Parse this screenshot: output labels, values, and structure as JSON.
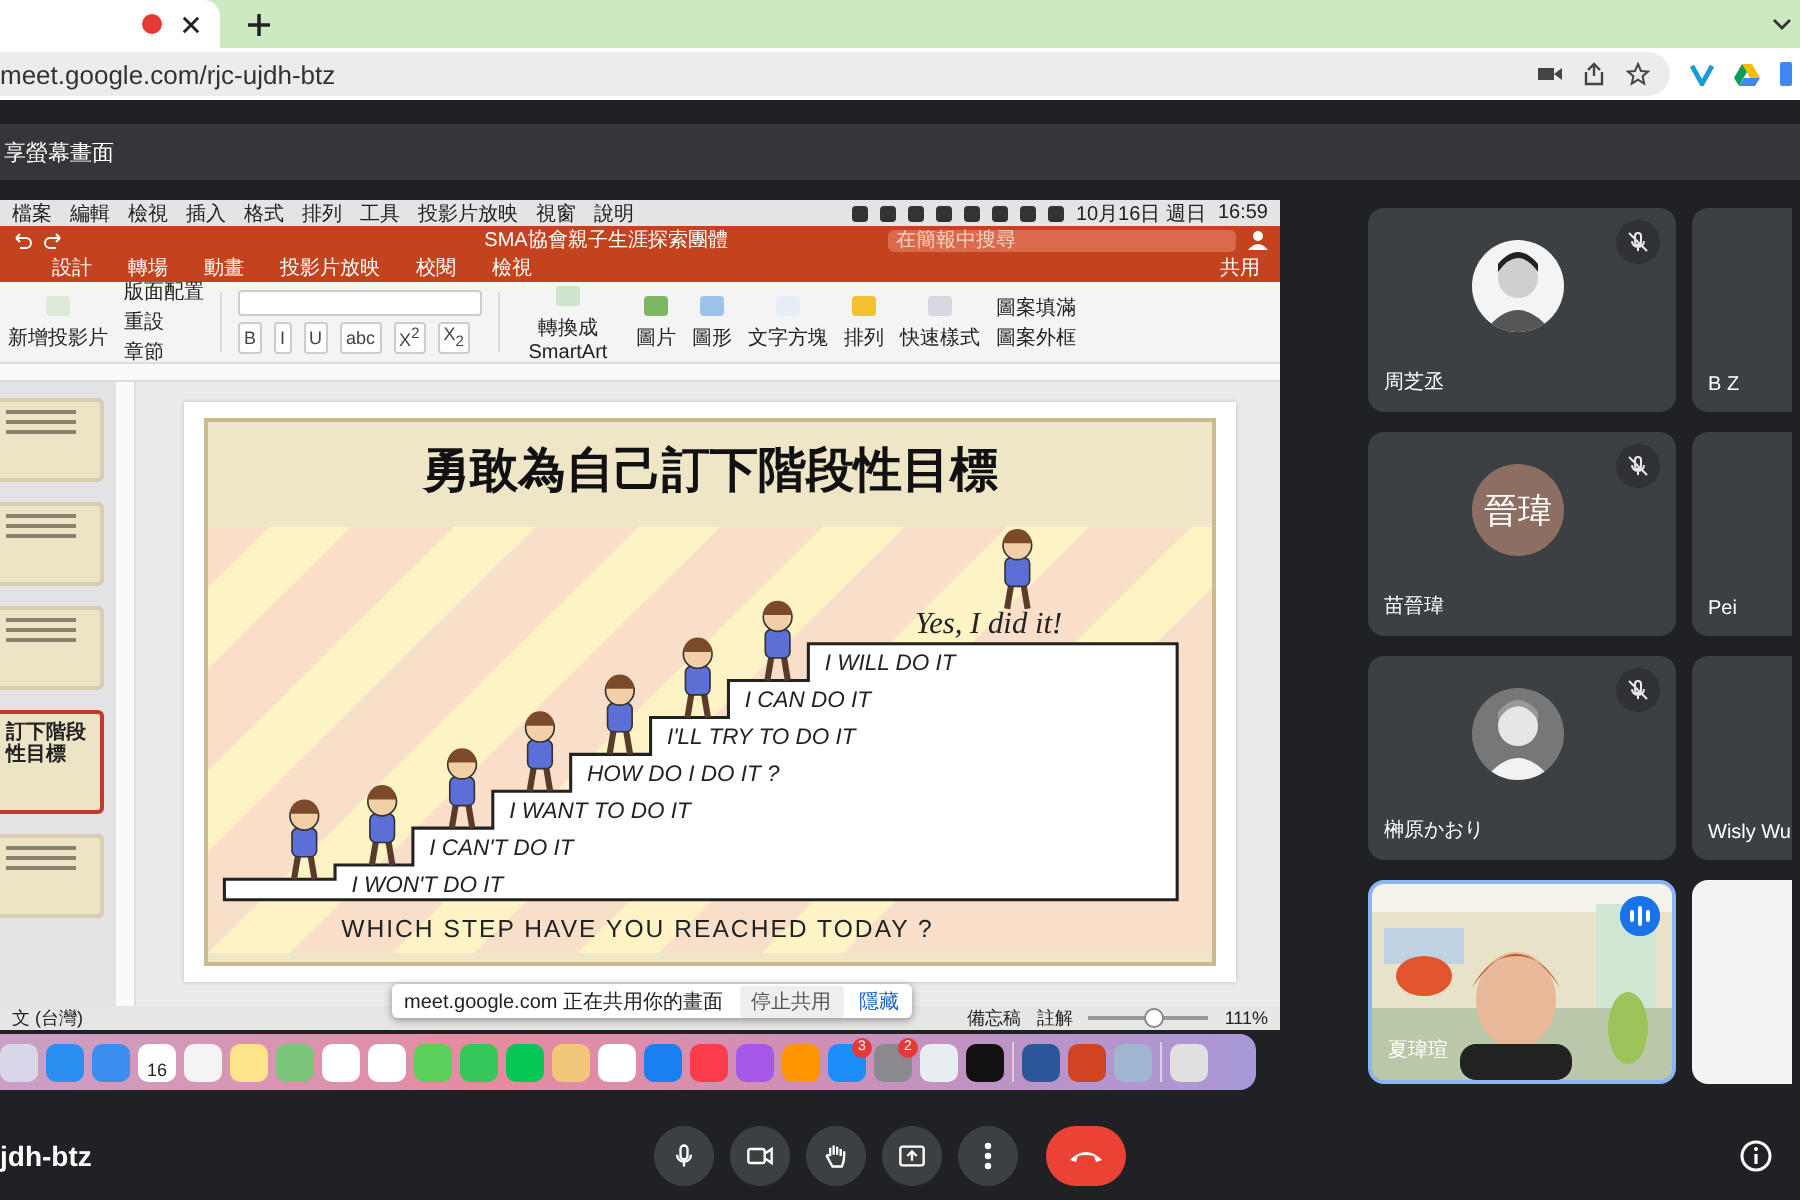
{
  "browser": {
    "url": "meet.google.com/rjc-ujdh-btz"
  },
  "meeting": {
    "banner": "享螢幕畫面",
    "code": "jdh-btz"
  },
  "shared_screen": {
    "menu_bar": {
      "items": [
        "檔案",
        "編輯",
        "檢視",
        "插入",
        "格式",
        "排列",
        "工具",
        "投影片放映",
        "視窗",
        "說明"
      ],
      "date": "10月16日 週日",
      "time": "16:59"
    },
    "ppt": {
      "title": "SMA協會親子生涯探索團體",
      "search_placeholder": "在簡報中搜尋",
      "tabs": [
        "設計",
        "轉場",
        "動畫",
        "投影片放映",
        "校閱",
        "檢視"
      ],
      "share": "共用",
      "ribbon": {
        "new_slide": "新增投影片",
        "layout": "版面配置",
        "reset": "重設",
        "section": "章節",
        "format_marks": [
          "B",
          "I",
          "U",
          "abc",
          "X$^{2}$",
          "X$_{2}$"
        ],
        "smartart": "轉換成 SmartArt",
        "picture": "圖片",
        "shapes": "圖形",
        "text_box": "文字方塊",
        "arrange": "排列",
        "quick_styles": "快速樣式",
        "shape_fill": "圖案填滿",
        "shape_outline": "圖案外框"
      }
    },
    "thumbnails": [
      {
        "selected": false
      },
      {
        "selected": false
      },
      {
        "selected": false
      },
      {
        "selected": true,
        "title": "訂下階段性目標"
      },
      {
        "selected": false
      }
    ],
    "slide": {
      "title": "勇敢為自己訂下階段性目標",
      "exclaim": "Yes, I did it!",
      "steps": [
        "I WILL DO IT",
        "I CAN DO IT",
        "I'LL TRY TO DO IT",
        "HOW DO I DO IT ?",
        "I WANT TO DO IT",
        "I CAN'T DO IT",
        "I WON'T DO IT"
      ],
      "caption": "WHICH STEP HAVE YOU REACHED TODAY ?"
    },
    "status_bar": {
      "language": "文 (台灣)",
      "notes": "備忘稿",
      "comments": "註解",
      "zoom": {
        "level": 0.55,
        "reading": "111%"
      }
    },
    "share_notice": {
      "message": "meet.google.com 正在共用你的畫面",
      "stop": "停止共用",
      "hide": "隱藏"
    },
    "dock": {
      "calendar_day": "16",
      "app_store_badge": "3",
      "settings_badge": "2"
    }
  },
  "participants": [
    {
      "name": "周芝丞",
      "kind": "avatar",
      "muted": true,
      "speaking": false
    },
    {
      "name": "B Z",
      "kind": "blank",
      "speaking": false
    },
    {
      "name": "苗晉瑋",
      "kind": "initials",
      "initials": "晉瑋",
      "color": "#8d6e63",
      "muted": true,
      "speaking": false
    },
    {
      "name": "Pei",
      "kind": "blank",
      "speaking": false
    },
    {
      "name": "榊原かおり",
      "kind": "avatar",
      "muted": true,
      "speaking": false
    },
    {
      "name": "Wisly Wu",
      "kind": "blank",
      "speaking": false
    },
    {
      "name": "夏瑋瑄",
      "kind": "video",
      "muted": false,
      "speaking": true
    },
    {
      "kind": "video",
      "speaking": false
    }
  ]
}
